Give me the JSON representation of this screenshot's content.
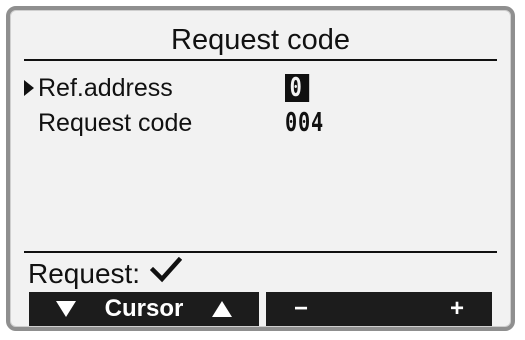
{
  "screen": {
    "title": "Request code"
  },
  "fields": [
    {
      "label": "Ref.address",
      "value": "0",
      "selected": true
    },
    {
      "label": "Request code",
      "value": "004",
      "selected": false
    }
  ],
  "status": {
    "label": "Request:",
    "icon": "checkmark-icon"
  },
  "softkeys": {
    "left_label": "Cursor",
    "left_icons": [
      "down-triangle-icon",
      "up-triangle-icon"
    ],
    "right_minus": "−",
    "right_plus": "+"
  }
}
